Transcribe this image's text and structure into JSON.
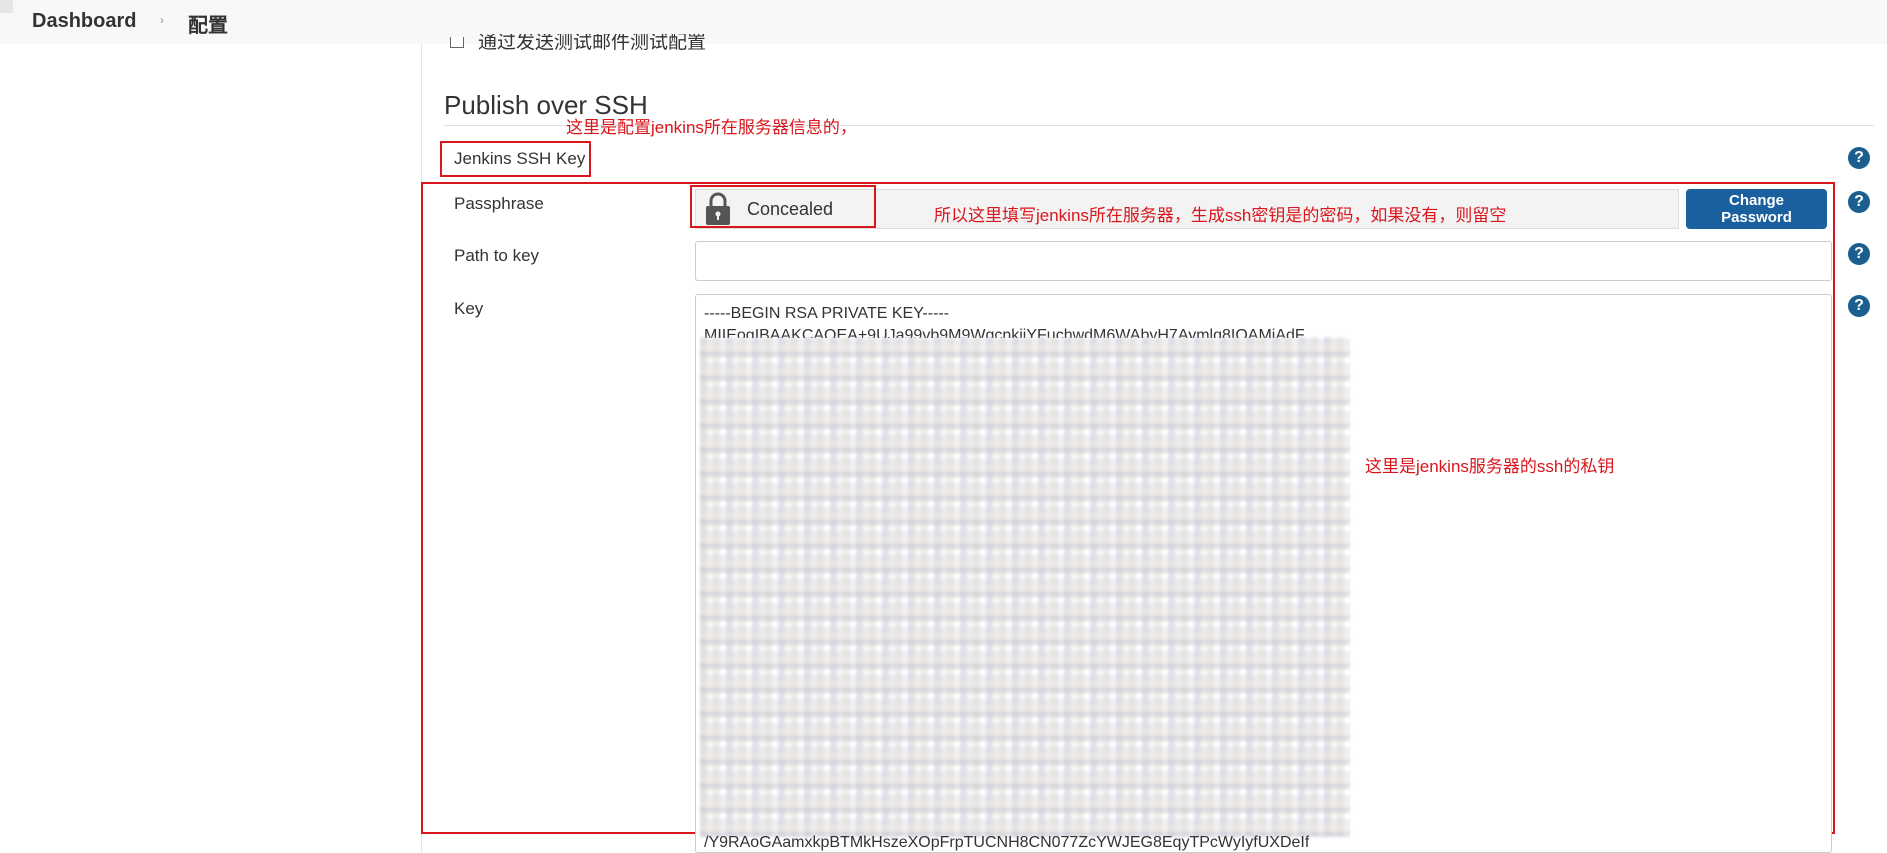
{
  "breadcrumb": {
    "home": "Dashboard",
    "separator": "›",
    "current": "配置"
  },
  "partial_checkbox_label": "通过发送测试邮件测试配置",
  "section": {
    "title": "Publish over SSH"
  },
  "annotations": {
    "top": "这里是配置jenkins所在服务器信息的，",
    "passphrase": "所以这里填写jenkins所在服务器，生成ssh密钥是的密码，如果没有，则留空",
    "key": "这里是jenkins服务器的ssh的私钥"
  },
  "ssh_key_heading": "Jenkins SSH Key",
  "fields": {
    "passphrase_label": "Passphrase",
    "passphrase_value": "Concealed",
    "change_password_label": "Change Password",
    "path_label": "Path to key",
    "path_value": "",
    "key_label": "Key",
    "key_first_line": "-----BEGIN RSA PRIVATE KEY-----",
    "key_second_line": "MIIEogIBAAKCAQEA+9UJa99vb9M9WgcnkjiYFuchwdM6WAbyH7Aymlq8IQAMiAdF",
    "key_last_line": "/Y9RAoGAamxkpBTMkHszeXOpFrpTUCNH8CN077ZcYWJEG8EqyTPcWyIyfUXDeIf"
  },
  "help_icon_glyph": "?",
  "colors": {
    "annotation_red": "#d9161c",
    "button_blue": "#1a5f9e",
    "help_blue": "#1a5f8f"
  }
}
